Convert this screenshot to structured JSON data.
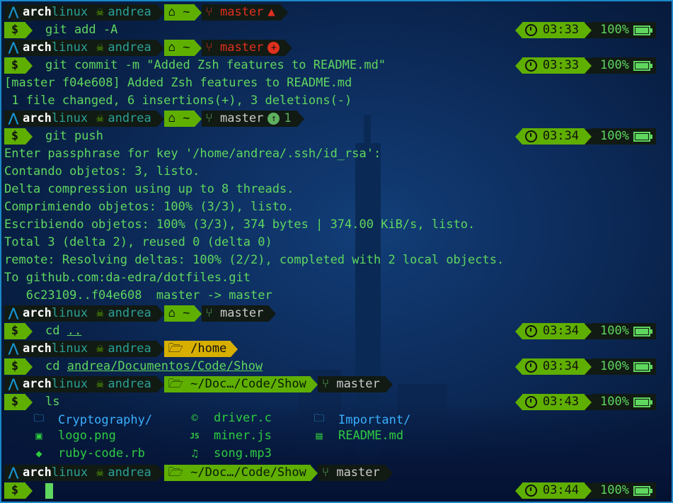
{
  "prompt": {
    "os_icon": "arch-linux-icon",
    "os_a": "arch",
    "os_b": "linux",
    "user": "andrea",
    "home_icon": "home-icon",
    "home_dir": "~",
    "branch": "master",
    "dollar": "$"
  },
  "lines": {
    "l1_cmd": "git add -A",
    "l1_time": "03:33",
    "l2_cmd": "git commit -m \"Added Zsh features to README.md\"",
    "l2_time": "03:33",
    "out1": "[master f04e608] Added Zsh features to README.md",
    "out2": " 1 file changed, 6 insertions(+), 3 deletions(-)",
    "ahead_count": "1",
    "l3_cmd": "git push",
    "l3_time": "03:34",
    "out3": "Enter passphrase for key '/home/andrea/.ssh/id_rsa':",
    "out4": "Contando objetos: 3, listo.",
    "out5": "Delta compression using up to 8 threads.",
    "out6": "Comprimiendo objetos: 100% (3/3), listo.",
    "out7": "Escribiendo objetos: 100% (3/3), 374 bytes | 374.00 KiB/s, listo.",
    "out8": "Total 3 (delta 2), reused 0 (delta 0)",
    "out9": "remote: Resolving deltas: 100% (2/2), completed with 2 local objects.",
    "out10": "To github.com:da-edra/dotfiles.git",
    "out11": "   6c23109..f04e608  master -> master",
    "l4_cmd_word": "cd",
    "l4_arg": "..",
    "l4_time": "03:34",
    "home_path": "/home",
    "l5_cmd_word": "cd",
    "l5_arg": "andrea/Documentos/Code/Show",
    "l5_time": "03:34",
    "show_path": "~/Doc…/Code/Show",
    "l6_cmd": "ls",
    "l6_time": "03:43",
    "l7_time": "03:44"
  },
  "battery": "100%",
  "ls": [
    {
      "name": "Cryptography/",
      "icon": "folder-icon",
      "color": "#3ab0ff"
    },
    {
      "name": "driver.c",
      "icon": "c-file-icon",
      "color": "#2ecc40"
    },
    {
      "name": "Important/",
      "icon": "folder-icon",
      "color": "#3ab0ff"
    },
    {
      "name": "logo.png",
      "icon": "image-icon",
      "color": "#2ecc40"
    },
    {
      "name": "miner.js",
      "icon": "js-file-icon",
      "color": "#2ecc40"
    },
    {
      "name": "README.md",
      "icon": "markdown-icon",
      "color": "#2ecc40"
    },
    {
      "name": "ruby-code.rb",
      "icon": "ruby-icon",
      "color": "#2ecc40"
    },
    {
      "name": "song.mp3",
      "icon": "music-icon",
      "color": "#2ecc40"
    }
  ],
  "colors": {
    "background": "#0d2c5c",
    "prompt_green": "#5faf00",
    "text_green": "#5fd75f",
    "git_red": "#e0301e",
    "dir_yellow": "#d7af00",
    "folder_blue": "#3ab0ff",
    "border": "#1a88c9"
  }
}
